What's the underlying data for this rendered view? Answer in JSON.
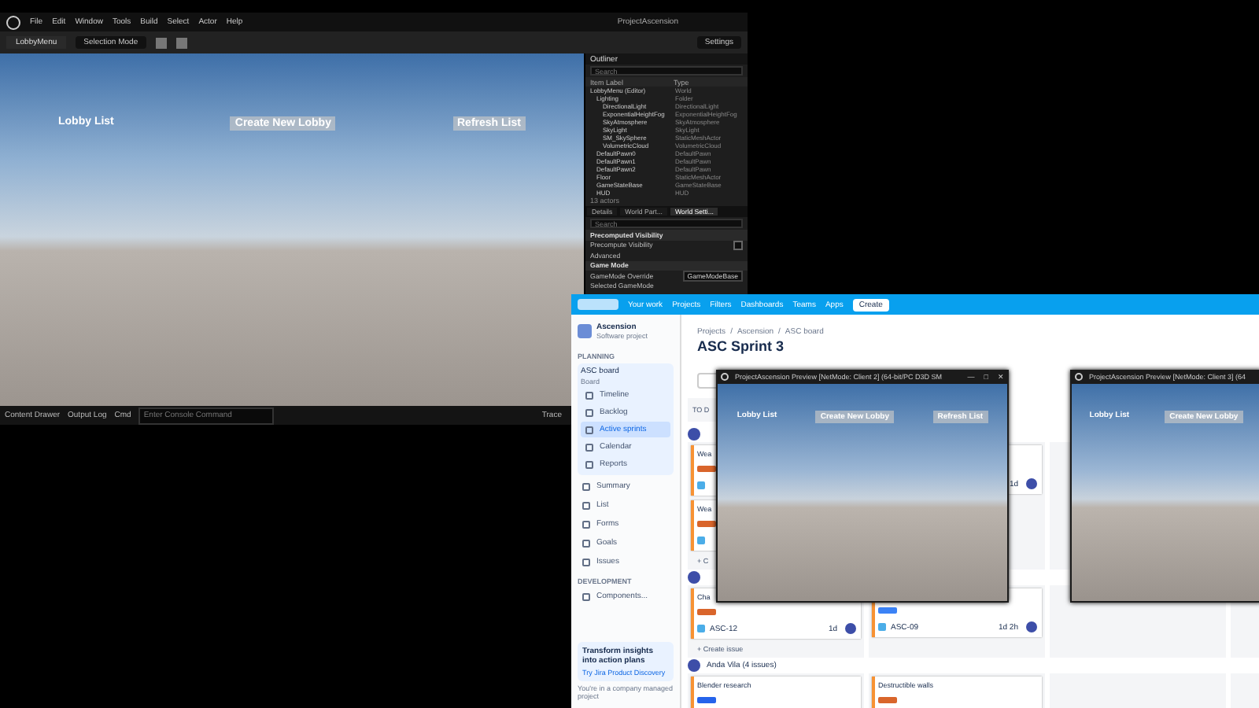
{
  "editor": {
    "title": "ProjectAscension",
    "menu": [
      "File",
      "Edit",
      "Window",
      "Tools",
      "Build",
      "Select",
      "Actor",
      "Help"
    ],
    "tab": "LobbyMenu",
    "mode": "Selection Mode",
    "settings": "Settings",
    "viewport_buttons": [
      {
        "label": "Lobby List",
        "kind": "text"
      },
      {
        "label": "Create New Lobby",
        "kind": "button"
      },
      {
        "label": "Refresh List",
        "kind": "button"
      }
    ],
    "outliner": {
      "title": "Outliner",
      "search": {
        "placeholder": "Search"
      },
      "columns": [
        "Item Label",
        "Type"
      ],
      "rows": [
        {
          "label": "LobbyMenu (Editor)",
          "type": "World",
          "children": [
            {
              "label": "Lighting",
              "type": "Folder",
              "children": [
                {
                  "label": "DirectionalLight",
                  "type": "DirectionalLight"
                },
                {
                  "label": "ExponentialHeightFog",
                  "type": "ExponentialHeightFog"
                },
                {
                  "label": "SkyAtmosphere",
                  "type": "SkyAtmosphere"
                },
                {
                  "label": "SkyLight",
                  "type": "SkyLight"
                },
                {
                  "label": "SM_SkySphere",
                  "type": "StaticMeshActor"
                },
                {
                  "label": "VolumetricCloud",
                  "type": "VolumetricCloud"
                }
              ]
            },
            {
              "label": "DefaultPawn0",
              "type": "DefaultPawn"
            },
            {
              "label": "DefaultPawn1",
              "type": "DefaultPawn"
            },
            {
              "label": "DefaultPawn2",
              "type": "DefaultPawn"
            },
            {
              "label": "Floor",
              "type": "StaticMeshActor"
            },
            {
              "label": "GameStateBase",
              "type": "GameStateBase"
            },
            {
              "label": "HUD",
              "type": "HUD"
            }
          ]
        }
      ],
      "count": "13 actors"
    },
    "details": {
      "tabs": [
        {
          "label": "Details",
          "selected": false
        },
        {
          "label": "World Part...",
          "selected": false
        },
        {
          "label": "World Setti...",
          "selected": true
        }
      ],
      "search": {
        "placeholder": "Search"
      },
      "rows": [
        {
          "kind": "section",
          "label": "Precomputed Visibility"
        },
        {
          "kind": "checkbox",
          "label": "Precompute Visibility",
          "checked": false
        },
        {
          "kind": "collapsed",
          "label": "Advanced"
        },
        {
          "kind": "section",
          "label": "Game Mode"
        },
        {
          "kind": "dropdown",
          "label": "GameMode Override",
          "value": "GameModeBase"
        },
        {
          "kind": "collapsed",
          "label": "Selected GameMode"
        }
      ]
    },
    "bottom_bar": {
      "buttons": [
        "Content Drawer",
        "Output Log",
        "Cmd"
      ],
      "console": {
        "placeholder": "Enter Console Command"
      },
      "trace": "Trace"
    }
  },
  "jira": {
    "nav": [
      "Your work",
      "Projects",
      "Filters",
      "Dashboards",
      "Teams",
      "Apps"
    ],
    "create": "Create",
    "project": {
      "name": "Ascension",
      "type": "Software project"
    },
    "planning": "PLANNING",
    "board": {
      "name": "ASC board",
      "sub": "Board"
    },
    "planning_items": [
      {
        "label": "Timeline",
        "selected": false
      },
      {
        "label": "Backlog",
        "selected": false
      },
      {
        "label": "Active sprints",
        "selected": true
      },
      {
        "label": "Calendar",
        "selected": false
      },
      {
        "label": "Reports",
        "selected": false
      }
    ],
    "items": [
      "Summary",
      "List",
      "Forms",
      "Goals",
      "Issues"
    ],
    "development": "DEVELOPMENT",
    "dev_items": [
      "Components..."
    ],
    "promo": {
      "title": "Transform insights into action plans",
      "link": "Try Jira Product Discovery"
    },
    "footer": "You're in a company managed project",
    "breadcrumbs": [
      {
        "label": "Projects"
      },
      {
        "separator": "/"
      },
      {
        "label": "Ascension"
      },
      {
        "separator": "/"
      },
      {
        "label": "ASC board"
      }
    ],
    "title": "ASC Sprint 3",
    "column_header": "TO D",
    "groups": [
      {
        "columns": [
          {
            "cards": [
              {
                "title": "Wea",
                "color": "#d9652b"
              },
              {
                "title": "Wea",
                "color": "#d9652b"
              }
            ]
          },
          {
            "cards": [
              {
                "estimate": "1d"
              }
            ]
          }
        ],
        "create": "+ C"
      },
      {
        "columns": [
          {
            "cards": [
              {
                "title": "Cha",
                "color": "#d9652b",
                "key": "ASC-12",
                "estimate": "1d"
              }
            ]
          },
          {
            "cards": [
              {
                "color": "#3b82f6",
                "key": "ASC-09",
                "estimate": "1d 2h"
              }
            ]
          }
        ],
        "create": "+ Create issue"
      },
      {
        "header": "Anda Vila  (4 issues)",
        "columns": [
          {
            "cards": [
              {
                "title": "Blender research",
                "color": "#2563eb"
              }
            ]
          },
          {
            "cards": [
              {
                "title": "Destructible walls",
                "color": "#d9652b"
              }
            ]
          }
        ]
      }
    ]
  },
  "previews": [
    {
      "title": "ProjectAscension Preview [NetMode: Client 2] (64-bit/PC D3D SM",
      "controls": [
        "—",
        "□",
        "✕"
      ],
      "buttons": [
        {
          "label": "Lobby List",
          "kind": "text"
        },
        {
          "label": "Create New Lobby",
          "kind": "button"
        },
        {
          "label": "Refresh List",
          "kind": "button"
        }
      ]
    },
    {
      "title": "ProjectAscension Preview [NetMode: Client 3] (64",
      "buttons": [
        {
          "label": "Lobby List",
          "kind": "text"
        },
        {
          "label": "Create New Lobby",
          "kind": "button"
        }
      ]
    }
  ]
}
